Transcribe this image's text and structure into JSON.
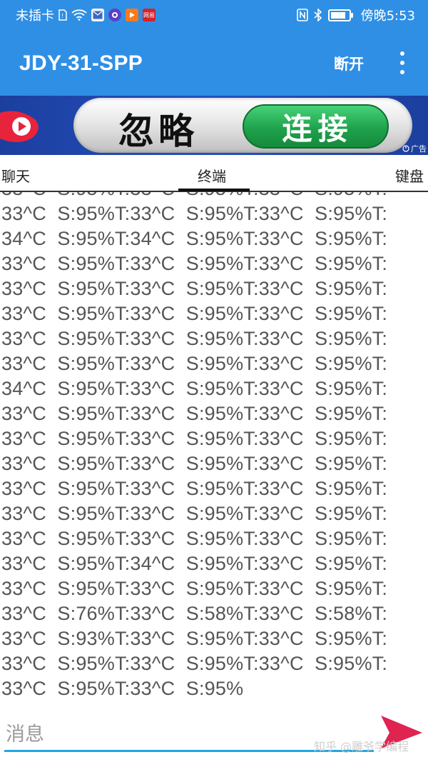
{
  "status_bar": {
    "carrier": "未插卡",
    "time": "傍晚5:53",
    "icons": [
      "sim-icon",
      "wifi-icon",
      "mail-icon",
      "app-icon",
      "video-app-icon",
      "netease-icon",
      "nfc-icon",
      "bluetooth-icon",
      "battery-icon"
    ],
    "netease_label": "网易"
  },
  "app_bar": {
    "title": "JDY-31-SPP",
    "disconnect_label": "断开"
  },
  "banner": {
    "ignore_text": "忽略",
    "connect_text": "连接",
    "ad_label": "广告"
  },
  "tabs": {
    "chat": "聊天",
    "terminal": "终端",
    "keyboard": "键盘",
    "active": "terminal"
  },
  "terminal": {
    "output": "33^C  S:95%T:33^C  S:95%T:33^C  S:95%T:\n33^C  S:95%T:33^C  S:95%T:33^C  S:95%T:\n34^C  S:95%T:34^C  S:95%T:33^C  S:95%T:\n33^C  S:95%T:33^C  S:95%T:33^C  S:95%T:\n33^C  S:95%T:33^C  S:95%T:33^C  S:95%T:\n33^C  S:95%T:33^C  S:95%T:33^C  S:95%T:\n33^C  S:95%T:33^C  S:95%T:33^C  S:95%T:\n33^C  S:95%T:33^C  S:95%T:33^C  S:95%T:\n34^C  S:95%T:33^C  S:95%T:33^C  S:95%T:\n33^C  S:95%T:33^C  S:95%T:33^C  S:95%T:\n33^C  S:95%T:33^C  S:95%T:33^C  S:95%T:\n33^C  S:95%T:33^C  S:95%T:33^C  S:95%T:\n33^C  S:95%T:33^C  S:95%T:33^C  S:95%T:\n33^C  S:95%T:33^C  S:95%T:33^C  S:95%T:\n33^C  S:95%T:33^C  S:95%T:33^C  S:95%T:\n33^C  S:95%T:34^C  S:95%T:33^C  S:95%T:\n33^C  S:95%T:33^C  S:95%T:33^C  S:95%T:\n33^C  S:76%T:33^C  S:58%T:33^C  S:58%T:\n33^C  S:93%T:33^C  S:95%T:33^C  S:95%T:\n33^C  S:95%T:33^C  S:95%T:33^C  S:95%T:\n33^C  S:95%T:33^C  S:95%"
  },
  "input": {
    "value": "",
    "placeholder": "消息"
  },
  "watermark": "知乎 @雕爷学编程",
  "colors": {
    "primary": "#2f8fe4",
    "input_underline": "#1ea7e0",
    "send_arrow": "#e02452",
    "connect_green": "#1fa24c"
  }
}
